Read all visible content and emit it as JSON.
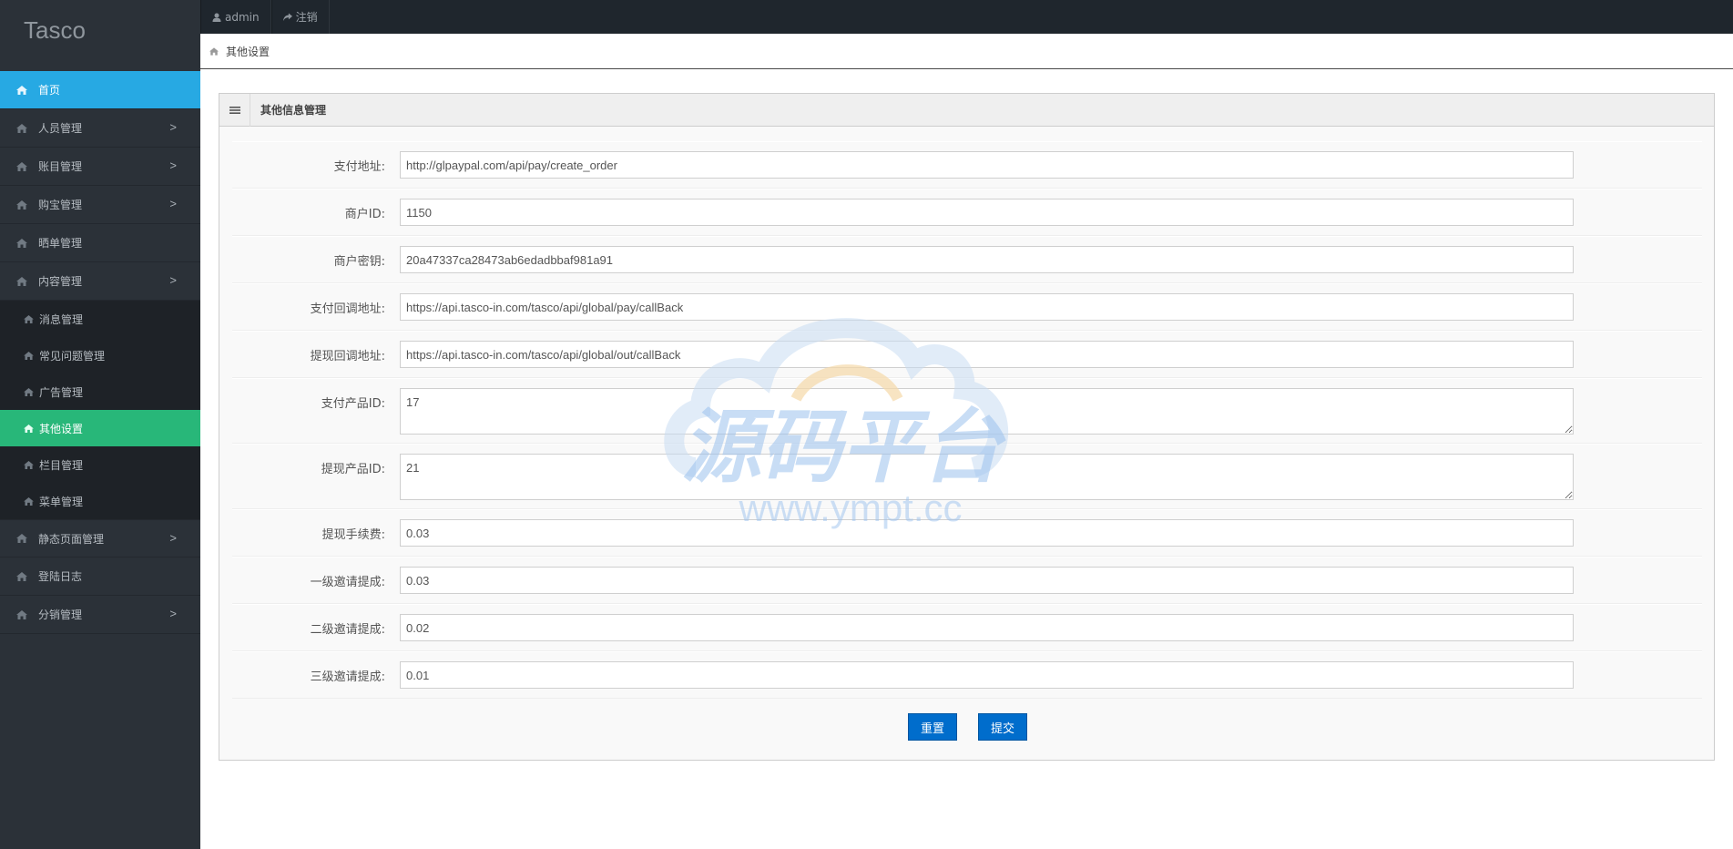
{
  "brand": "Tasco",
  "topbar": {
    "user_label": "admin",
    "logout_label": "注销"
  },
  "breadcrumb": {
    "current": "其他设置"
  },
  "sidebar": {
    "items": [
      {
        "label": "首页",
        "has_arrow": false,
        "active": true
      },
      {
        "label": "人员管理",
        "has_arrow": true
      },
      {
        "label": "账目管理",
        "has_arrow": true
      },
      {
        "label": "购宝管理",
        "has_arrow": true
      },
      {
        "label": "晒单管理",
        "has_arrow": false
      },
      {
        "label": "内容管理",
        "has_arrow": true
      }
    ],
    "sub_items": [
      {
        "label": "消息管理"
      },
      {
        "label": "常见问题管理"
      },
      {
        "label": "广告管理"
      },
      {
        "label": "其他设置",
        "active": true
      },
      {
        "label": "栏目管理"
      },
      {
        "label": "菜单管理"
      }
    ],
    "items_after": [
      {
        "label": "静态页面管理",
        "has_arrow": true
      },
      {
        "label": "登陆日志",
        "has_arrow": false
      },
      {
        "label": "分销管理",
        "has_arrow": true
      }
    ],
    "arrow_glyph": ">"
  },
  "panel": {
    "title": "其他信息管理"
  },
  "form": {
    "pay_url": {
      "label": "支付地址:",
      "value": "http://glpaypal.com/api/pay/create_order"
    },
    "merchant_id": {
      "label": "商户ID:",
      "value": "1150"
    },
    "merchant_key": {
      "label": "商户密钥:",
      "value": "20a47337ca28473ab6edadbbaf981a91"
    },
    "pay_callback": {
      "label": "支付回调地址:",
      "value": "https://api.tasco-in.com/tasco/api/global/pay/callBack"
    },
    "withdraw_callback": {
      "label": "提现回调地址:",
      "value": "https://api.tasco-in.com/tasco/api/global/out/callBack"
    },
    "pay_product_id": {
      "label": "支付产品ID:",
      "value": "17"
    },
    "withdraw_product_id": {
      "label": "提现产品ID:",
      "value": "21"
    },
    "withdraw_fee": {
      "label": "提现手续费:",
      "value": "0.03"
    },
    "level1_commission": {
      "label": "一级邀请提成:",
      "value": "0.03"
    },
    "level2_commission": {
      "label": "二级邀请提成:",
      "value": "0.02"
    },
    "level3_commission": {
      "label": "三级邀请提成:",
      "value": "0.01"
    }
  },
  "buttons": {
    "reset": "重置",
    "submit": "提交"
  },
  "watermark": {
    "text": "源码平台",
    "url": "www.ympt.cc"
  },
  "colors": {
    "sidebar_bg": "#2b3138",
    "active_blue": "#27a9e3",
    "active_green": "#28b779",
    "button_blue": "#006dcc"
  }
}
